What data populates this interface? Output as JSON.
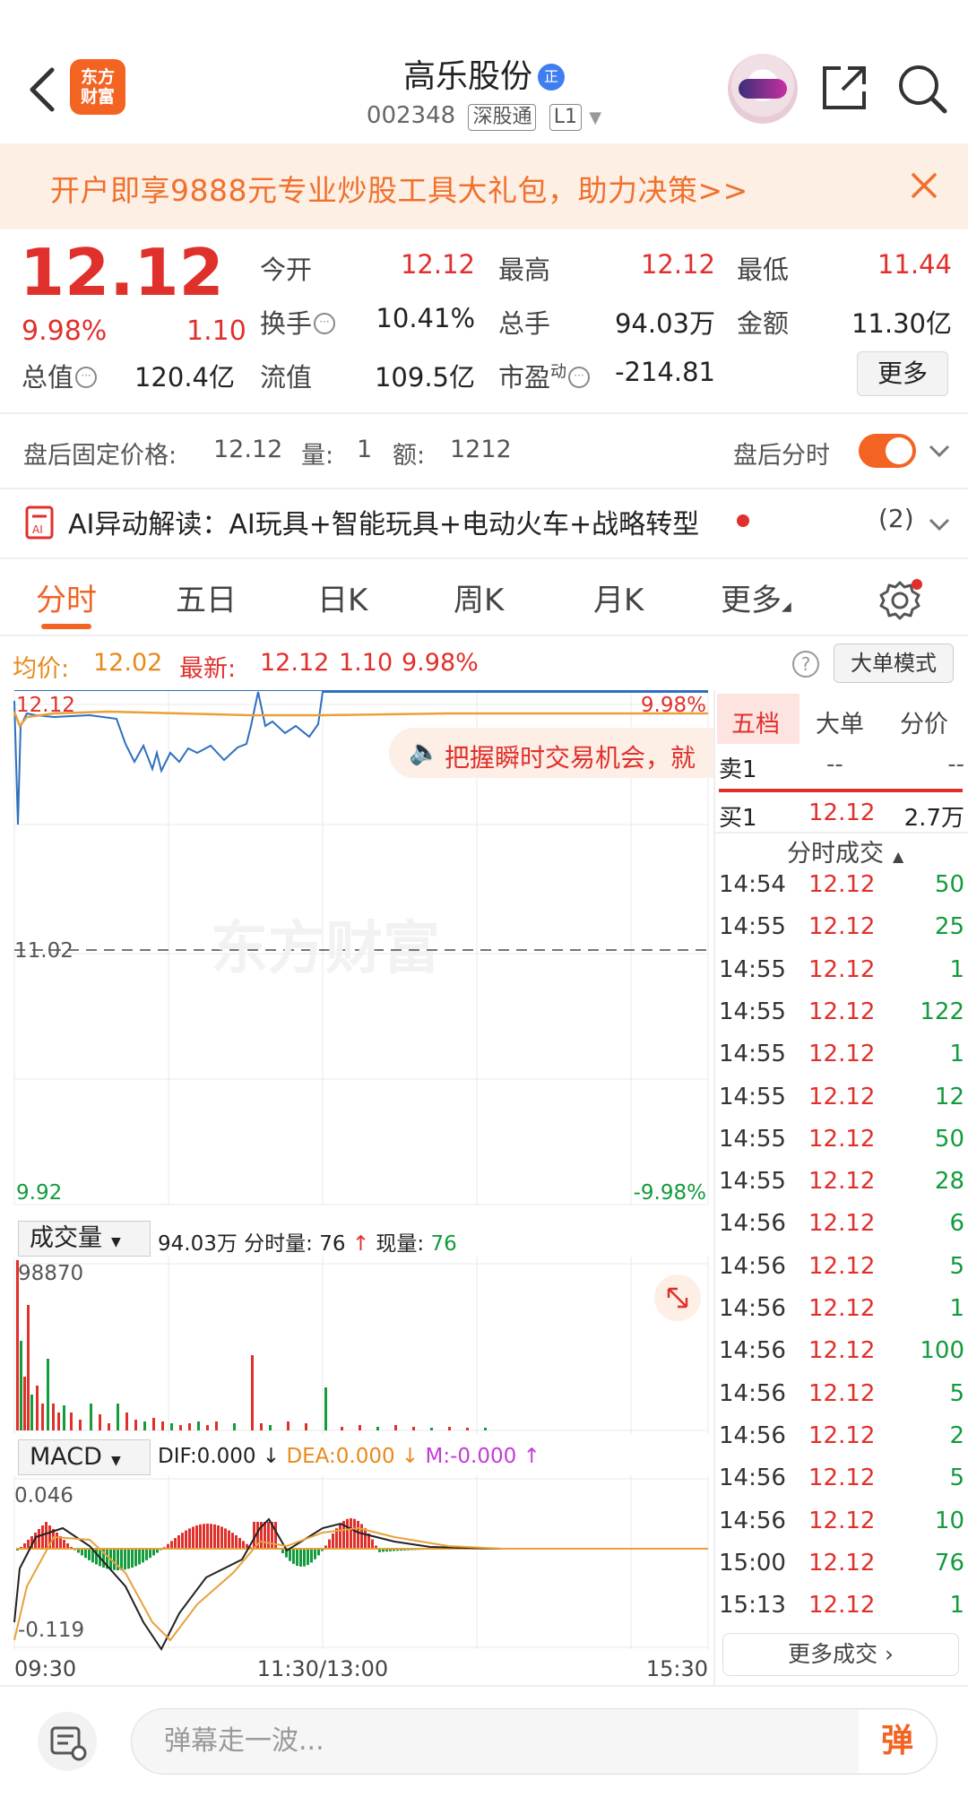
{
  "header": {
    "logo_text": "东方财富",
    "stock_name": "高乐股份",
    "verified_badge": "正",
    "stock_code": "002348",
    "tag_connect": "深股通",
    "tag_level": "L1"
  },
  "promo": {
    "text": "开户即享9888元专业炒股工具大礼包，助力决策>>"
  },
  "quote": {
    "price": "12.12",
    "change_pct": "9.98%",
    "change_amt": "1.10",
    "stats": [
      {
        "label": "今开",
        "value": "12.12",
        "color": "red"
      },
      {
        "label": "最高",
        "value": "12.12",
        "color": "red"
      },
      {
        "label": "最低",
        "value": "11.44",
        "color": "red"
      },
      {
        "label": "换手",
        "value": "10.41%",
        "color": "black"
      },
      {
        "label": "总手",
        "value": "94.03万",
        "color": "black"
      },
      {
        "label": "金额",
        "value": "11.30亿",
        "color": "black"
      },
      {
        "label": "总值",
        "value": "120.4亿",
        "color": "black"
      },
      {
        "label": "流值",
        "value": "109.5亿",
        "color": "black"
      },
      {
        "label": "市盈",
        "label_sup": "动",
        "value": "-214.81",
        "color": "black"
      }
    ],
    "more_label": "更多"
  },
  "after_hours": {
    "label": "盘后固定价格:",
    "price": "12.12",
    "vol_label": "量:",
    "vol": "1",
    "amt_label": "额:",
    "amt": "1212",
    "toggle_label": "盘后分时",
    "toggle_on": true
  },
  "ai": {
    "text": "AI异动解读：AI玩具+智能玩具+电动火车+战略转型",
    "count": "(2)"
  },
  "tabs": [
    "分时",
    "五日",
    "日K",
    "周K",
    "月K",
    "更多"
  ],
  "chart_header": {
    "avg_label": "均价:",
    "avg_value": "12.02",
    "latest_label": "最新:",
    "latest_value": "12.12",
    "latest_change": "1.10",
    "latest_pct": "9.98%",
    "big_order_label": "大单模式"
  },
  "chart_data": {
    "type": "line",
    "price_axis": {
      "top": "12.12",
      "mid": "11.02",
      "bottom": "9.92",
      "top_pct": "9.98%",
      "bottom_pct": "-9.98%"
    },
    "time_labels": [
      "09:30",
      "11:30/13:00",
      "15:30"
    ],
    "watermark": "东方财富",
    "floating_tip": "把握瞬时交易机会，就",
    "volume": {
      "selector": "成交量",
      "total": "94.03万",
      "min_vol_label": "分时量:",
      "min_vol": "76",
      "now_label": "现量:",
      "now": "76",
      "max": "98870"
    },
    "macd": {
      "selector": "MACD",
      "dif": "DIF:0.000",
      "dea": "DEA:0.000",
      "m": "M:-0.000",
      "max": "0.046",
      "min": "-0.119"
    },
    "colors": {
      "price": "#2f6fc0",
      "avg": "#e8a13a",
      "up": "#e0302b",
      "down": "#139b3c"
    }
  },
  "side": {
    "tabs": [
      "五档",
      "大单",
      "分价"
    ],
    "sell1": {
      "label": "卖1",
      "price": "--",
      "vol": "--"
    },
    "buy1": {
      "label": "买1",
      "price": "12.12",
      "vol": "2.7万"
    },
    "trade_title": "分时成交",
    "trades": [
      {
        "time": "14:54",
        "price": "12.12",
        "vol": "50"
      },
      {
        "time": "14:55",
        "price": "12.12",
        "vol": "25"
      },
      {
        "time": "14:55",
        "price": "12.12",
        "vol": "1"
      },
      {
        "time": "14:55",
        "price": "12.12",
        "vol": "122"
      },
      {
        "time": "14:55",
        "price": "12.12",
        "vol": "1"
      },
      {
        "time": "14:55",
        "price": "12.12",
        "vol": "12"
      },
      {
        "time": "14:55",
        "price": "12.12",
        "vol": "50"
      },
      {
        "time": "14:55",
        "price": "12.12",
        "vol": "28"
      },
      {
        "time": "14:56",
        "price": "12.12",
        "vol": "6"
      },
      {
        "time": "14:56",
        "price": "12.12",
        "vol": "5"
      },
      {
        "time": "14:56",
        "price": "12.12",
        "vol": "1"
      },
      {
        "time": "14:56",
        "price": "12.12",
        "vol": "100"
      },
      {
        "time": "14:56",
        "price": "12.12",
        "vol": "5"
      },
      {
        "time": "14:56",
        "price": "12.12",
        "vol": "2"
      },
      {
        "time": "14:56",
        "price": "12.12",
        "vol": "5"
      },
      {
        "time": "14:56",
        "price": "12.12",
        "vol": "10"
      },
      {
        "time": "15:00",
        "price": "12.12",
        "vol": "76"
      },
      {
        "time": "15:13",
        "price": "12.12",
        "vol": "1"
      }
    ],
    "more_trades": "更多成交"
  },
  "bottom": {
    "placeholder": "弹幕走一波...",
    "send_label": "弹"
  }
}
